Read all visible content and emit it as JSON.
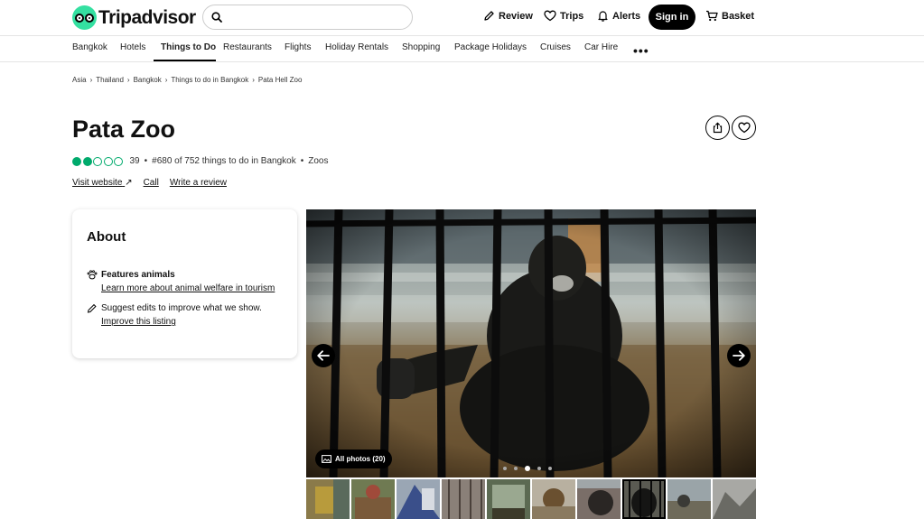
{
  "header": {
    "logo_text": "Tripadvisor",
    "search": {
      "placeholder": "",
      "value": ""
    },
    "nav": {
      "review": "Review",
      "trips": "Trips",
      "alerts": "Alerts",
      "sign_in": "Sign in",
      "basket": "Basket"
    }
  },
  "categories": {
    "items": [
      "Bangkok",
      "Hotels",
      "Things to Do",
      "Restaurants",
      "Flights",
      "Holiday Rentals",
      "Shopping",
      "Package Holidays",
      "Cruises",
      "Car Hire"
    ],
    "active": "Things to Do",
    "more": "•••"
  },
  "breadcrumb": {
    "items": [
      "Asia",
      "Thailand",
      "Bangkok",
      "Things to do in Bangkok",
      "Pata Hell Zoo"
    ],
    "separator": "›"
  },
  "listing": {
    "title": "Pata Zoo",
    "rating": {
      "bubbles_filled": 2,
      "bubbles_total": 5,
      "review_count": "39",
      "separator": "•"
    },
    "ranking": "#680 of 752 things to do in Bangkok",
    "category": "Zoos",
    "links": {
      "website": "Visit website",
      "website_arrow": "↗",
      "call": "Call",
      "write_review": "Write a review"
    }
  },
  "about": {
    "heading": "About",
    "feature_title": "Features animals",
    "feature_link": "Learn more about animal welfare in tourism",
    "suggest_text": "Suggest edits to improve what we show.",
    "suggest_link": "Improve this listing"
  },
  "gallery": {
    "all_photos": "All photos (20)",
    "dots_total": 5,
    "dot_active": 3,
    "thumb_count": 10,
    "thumb_selected": 8
  },
  "colors": {
    "brand_green": "#34e0a1",
    "bubble_green": "#00aa6c",
    "black": "#000000"
  }
}
